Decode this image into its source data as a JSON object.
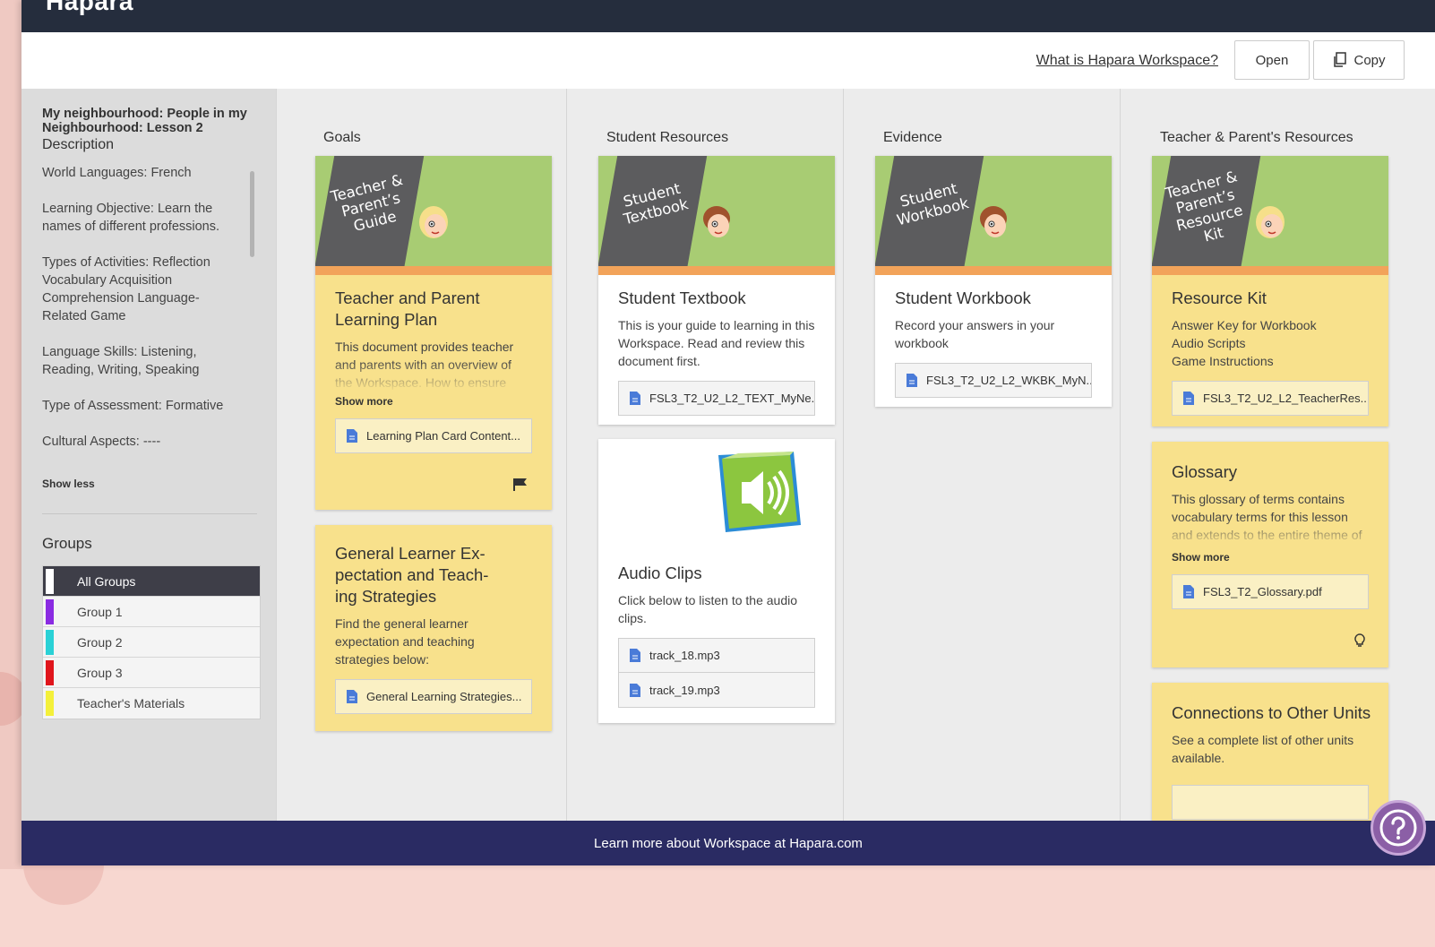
{
  "app": {
    "logo": "Hapara"
  },
  "toolbar": {
    "what_link": "What is Hapara Workspace?",
    "open_label": "Open",
    "copy_label": "Copy"
  },
  "sidebar": {
    "title": "My neighbourhood: People in my Neighbourhood: Lesson 2",
    "description_heading": "Description",
    "description": [
      "World Languages: French",
      "Learning Objective: Learn the names of different professions.",
      "Types of Activities: Reflection Vocabulary Acquisition Comprehension Language-Related Game",
      "Language Skills:  Listening, Reading, Writing, Speaking",
      "Type of Assessment: Formative",
      "Cultural Aspects: ----"
    ],
    "show_less": "Show less",
    "groups_heading": "Groups",
    "groups": [
      {
        "label": "All Groups",
        "color": "#ffffff"
      },
      {
        "label": "Group 1",
        "color": "#8a2be2"
      },
      {
        "label": "Group 2",
        "color": "#2ad1d6"
      },
      {
        "label": "Group 3",
        "color": "#e0151c"
      },
      {
        "label": "Teacher's Materials",
        "color": "#f4f03a"
      }
    ]
  },
  "columns": {
    "goals": {
      "heading": "Goals",
      "card1": {
        "image_text": "Teacher & Parent’s Guide",
        "title": "Teacher and Parent Learning Plan",
        "text": "This document provides teacher and parents with an overview of the Workspace. How to ensure student learning, and use the",
        "show_more": "Show more",
        "file": "Learning Plan Card Content..."
      },
      "card2": {
        "title": "General Learner Ex-pectation and Teach-ing Strategies",
        "text": "Find the general learner expectation and teaching strategies below:",
        "file": "General Learning Strategies..."
      }
    },
    "student_resources": {
      "heading": "Student Resources",
      "card1": {
        "image_text": "Student Textbook",
        "title": "Student Textbook",
        "text": "This is your guide to learning in this Workspace. Read and review this document first.",
        "file": "FSL3_T2_U2_L2_TEXT_MyNe..."
      },
      "card2": {
        "title": "Audio Clips",
        "text": "Click below to listen to the audio clips.",
        "files": [
          "track_18.mp3",
          "track_19.mp3"
        ]
      }
    },
    "evidence": {
      "heading": "Evidence",
      "card1": {
        "image_text": "Student Workbook",
        "title": "Student Workbook",
        "text": "Record your answers in your workbook",
        "file": "FSL3_T2_U2_L2_WKBK_MyN..."
      }
    },
    "teacher_parent": {
      "heading": "Teacher & Parent's Resources",
      "card1": {
        "image_text": "Teacher & Parent’s Resource Kit",
        "title": "Resource Kit",
        "lines": [
          "Answer Key for Workbook",
          "Audio Scripts",
          "Game Instructions"
        ],
        "file": "FSL3_T2_U2_L2_TeacherRes..."
      },
      "card2": {
        "title": "Glossary",
        "text": "This glossary of terms contains vocabulary terms for this lesson and extends to the entire theme of “My Neighbourhood”",
        "show_more": "Show more",
        "file": "FSL3_T2_Glossary.pdf"
      },
      "card3": {
        "title": "Connections to Other Units",
        "text": "See a complete list of other units available."
      }
    }
  },
  "footer": {
    "text": "Learn more about Workspace at Hapara.com"
  },
  "colors": {
    "topbar": "#252d3d",
    "footer": "#2a2b63",
    "card_yellow": "#f8e18c",
    "image_green": "#a8cc73",
    "image_orange": "#f2a35a"
  }
}
